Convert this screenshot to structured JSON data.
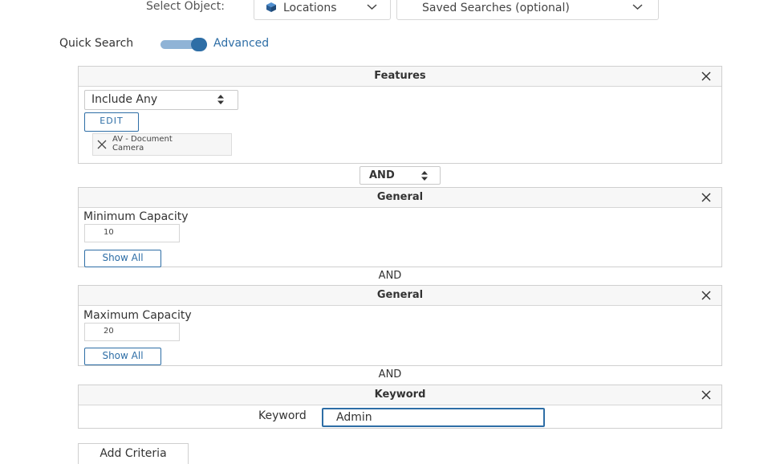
{
  "top_bar": {
    "select_object_label": "Select Object:",
    "object_value": "Locations",
    "saved_searches_placeholder": "Saved Searches (optional)"
  },
  "mode_toggle": {
    "left_label": "Quick Search",
    "right_label": "Advanced",
    "state": "Advanced"
  },
  "features_panel": {
    "title": "Features",
    "include_value": "Include Any",
    "edit_label": "EDIT",
    "chip_line1": "AV - Document",
    "chip_line2": "Camera"
  },
  "connector_select": {
    "value": "AND"
  },
  "min_panel": {
    "title": "General",
    "field_label": "Minimum Capacity",
    "value": "10",
    "show_all_label": "Show All"
  },
  "and_1": "AND",
  "max_panel": {
    "title": "General",
    "field_label": "Maximum Capacity",
    "value": "20",
    "show_all_label": "Show All"
  },
  "and_2": "AND",
  "keyword_panel": {
    "title": "Keyword",
    "field_label": "Keyword",
    "value": "Admin"
  },
  "add_criteria_label": "Add Criteria",
  "colors": {
    "accent": "#2e6ea6",
    "toggle_track": "#8fb3d6",
    "border": "#cfcfcf",
    "header_bg": "#f7f7f7"
  }
}
